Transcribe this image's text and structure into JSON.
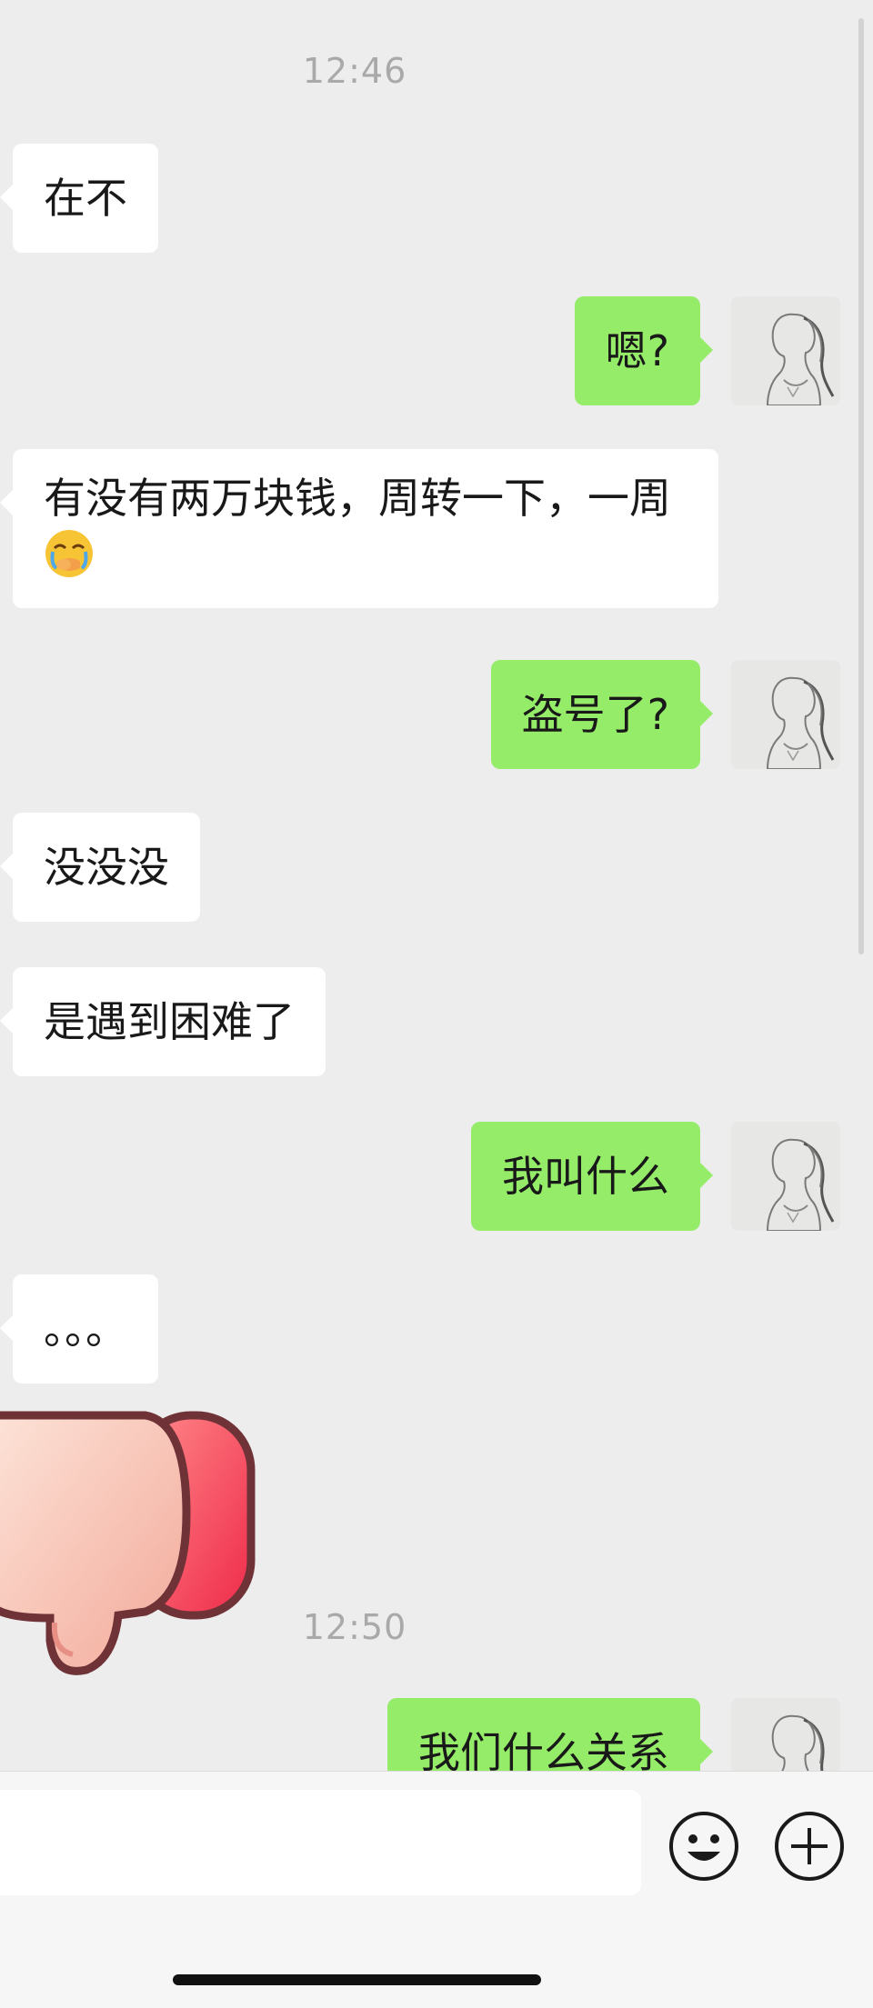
{
  "conversation": {
    "timestamps": [
      "12:46",
      "12:50"
    ],
    "messages": [
      {
        "from": "them",
        "text": "在不"
      },
      {
        "from": "me",
        "text": "嗯?"
      },
      {
        "from": "them",
        "text": "有没有两万块钱，周转一下，一周",
        "emoji": "face-with-hand-over-mouth-crying"
      },
      {
        "from": "me",
        "text": "盗号了?"
      },
      {
        "from": "them",
        "text": "没没没"
      },
      {
        "from": "them",
        "text": "是遇到困难了"
      },
      {
        "from": "me",
        "text": "我叫什么"
      },
      {
        "from": "them",
        "text": "。。。"
      },
      {
        "from": "them",
        "sticker": "thumbs-down-sticker"
      },
      {
        "from": "me",
        "text": "我们什么关系"
      }
    ]
  },
  "composer": {
    "input_value": "",
    "emoji_button_icon": "smiley-face-icon",
    "more_button_icon": "plus-circle-icon"
  },
  "colors": {
    "background": "#ededed",
    "outgoing_bubble": "#95ec69",
    "incoming_bubble": "#ffffff",
    "timestamp": "#a9a9a9"
  }
}
